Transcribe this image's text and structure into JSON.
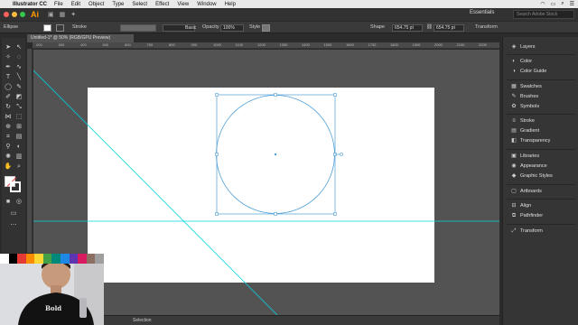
{
  "menubar": {
    "app_name": "Illustrator CC",
    "menus": [
      "File",
      "Edit",
      "Object",
      "Type",
      "Select",
      "Effect",
      "View",
      "Window",
      "Help"
    ]
  },
  "appbar": {
    "logo": "Ai",
    "workspace": "Essentials",
    "search_placeholder": "Search Adobe Stock"
  },
  "controlbar": {
    "selection_label": "Ellipse",
    "stroke_label": "Stroke",
    "brush_label": "Basic",
    "opacity_label": "Opacity",
    "opacity_value": "100%",
    "style_label": "Style",
    "shape_label": "Shape",
    "width_value": "654.75 pt",
    "height_value": "654.75 pt",
    "transform_label": "Transform"
  },
  "document": {
    "tab_title": "Untitled-1* @ 50% (RGB/GPU Preview)",
    "status_text": "Selection"
  },
  "ruler_ticks": [
    "200",
    "300",
    "400",
    "500",
    "600",
    "700",
    "800",
    "900",
    "1000",
    "1100",
    "1200",
    "1300",
    "1400",
    "1500",
    "1600",
    "1700",
    "1800",
    "1900",
    "2000",
    "2100",
    "2200"
  ],
  "panels": [
    {
      "label": "Layers",
      "icon": "layers-icon"
    },
    {
      "label": "Color",
      "icon": "color-icon"
    },
    {
      "label": "Color Guide",
      "icon": "color-guide-icon"
    },
    {
      "label": "Swatches",
      "icon": "swatches-icon"
    },
    {
      "label": "Brushes",
      "icon": "brushes-icon"
    },
    {
      "label": "Symbols",
      "icon": "symbols-icon"
    },
    {
      "label": "Stroke",
      "icon": "stroke-icon"
    },
    {
      "label": "Gradient",
      "icon": "gradient-icon"
    },
    {
      "label": "Transparency",
      "icon": "transparency-icon"
    },
    {
      "label": "Libraries",
      "icon": "libraries-icon"
    },
    {
      "label": "Appearance",
      "icon": "appearance-icon"
    },
    {
      "label": "Graphic Styles",
      "icon": "graphic-styles-icon"
    },
    {
      "label": "Artboards",
      "icon": "artboards-icon"
    },
    {
      "label": "Align",
      "icon": "align-icon"
    },
    {
      "label": "Pathfinder",
      "icon": "pathfinder-icon"
    },
    {
      "label": "Transform",
      "icon": "transform-icon"
    }
  ],
  "webcam": {
    "shirt_text": "Bold"
  },
  "colors": {
    "accent": "#ff9a00",
    "selection_blue": "#4f9fd6",
    "guide_cyan": "#00d4e0",
    "artboard": "#ffffff",
    "pasteboard": "#535353"
  }
}
